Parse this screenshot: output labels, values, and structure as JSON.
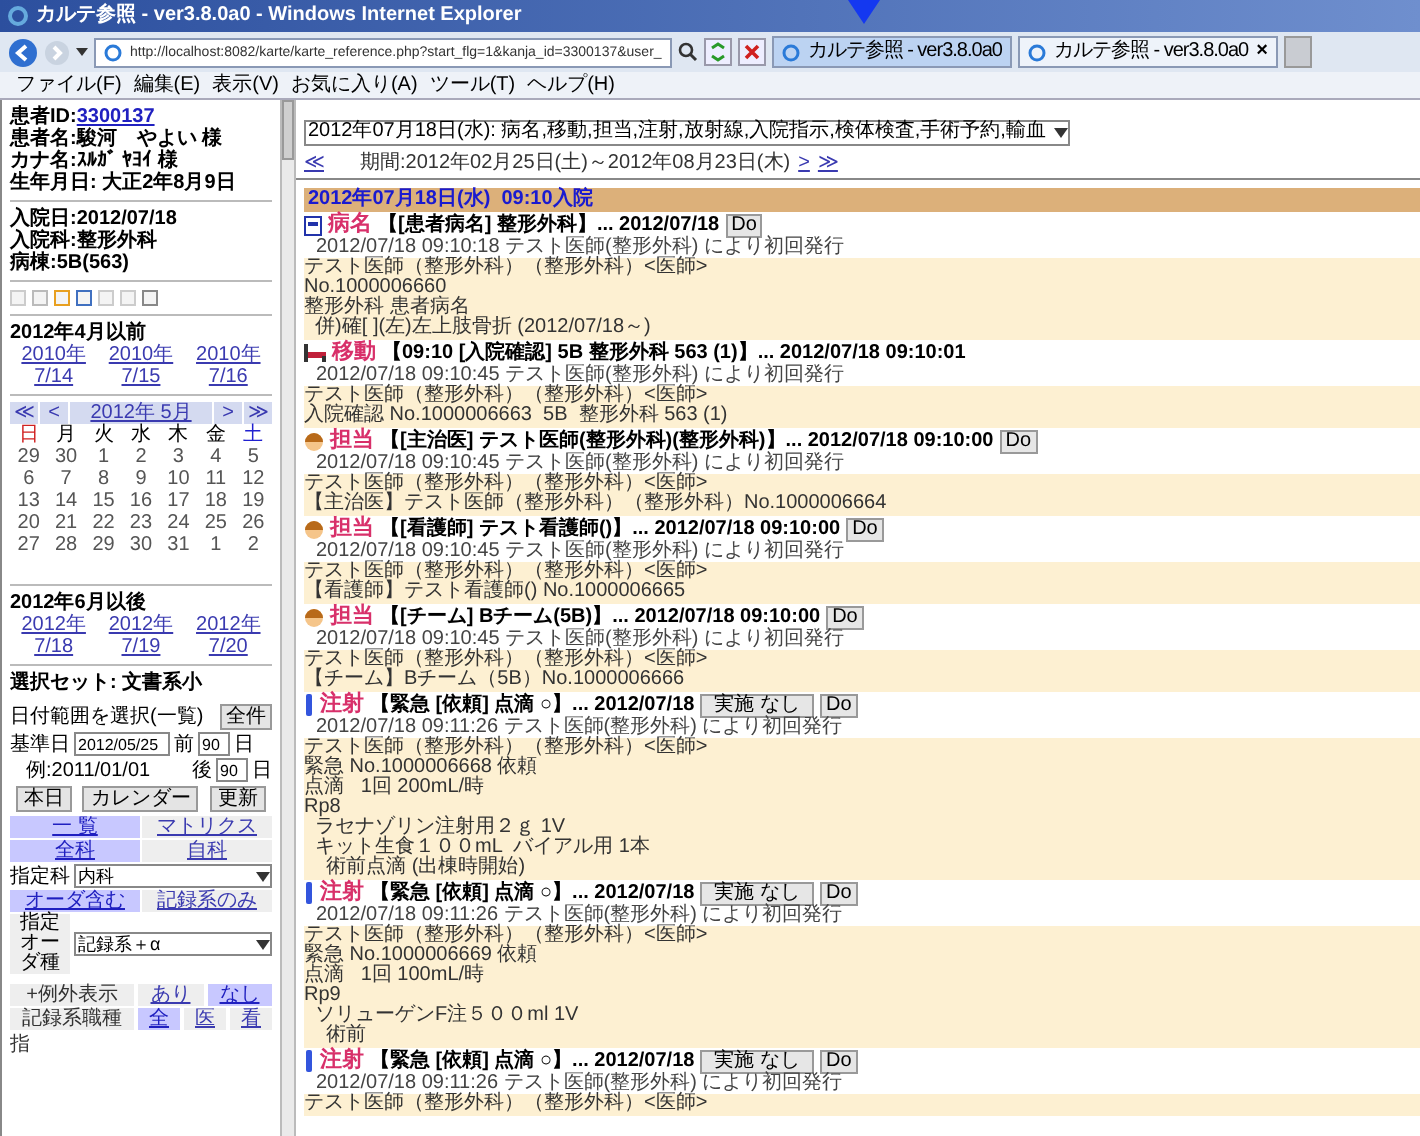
{
  "window": {
    "title": "カルテ参照 - ver3.8.0a0 - Windows Internet Explorer"
  },
  "address_bar": {
    "url": "http://localhost:8082/karte/karte_reference.php?start_flg=1&kanja_id=3300137&user_"
  },
  "tabs": [
    {
      "label": "カルテ参照 - ver3.8.0a0",
      "selected": false
    },
    {
      "label": "カルテ参照 - ver3.8.0a0",
      "selected": true,
      "close": "×"
    }
  ],
  "menu": [
    "ファイル(F)",
    "編集(E)",
    "表示(V)",
    "お気に入り(A)",
    "ツール(T)",
    "ヘルプ(H)"
  ],
  "patient": {
    "id_label": "患者ID:",
    "id": "3300137",
    "lines": [
      "患者名:駿河　やよい 様",
      "カナ名:ｽﾙｶﾞ ﾔﾖｲ 様",
      "生年月日: 大正2年8月9日"
    ]
  },
  "admission": [
    "入院日:2012/07/18",
    "入院科:整形外科",
    "病棟:5B(563)"
  ],
  "before": {
    "title": "2012年4月以前",
    "links": [
      {
        "year": "2010年",
        "date": "7/14"
      },
      {
        "year": "2010年",
        "date": "7/15"
      },
      {
        "year": "2010年",
        "date": "7/16"
      }
    ]
  },
  "calendar": {
    "nav_left": [
      "≪",
      "<"
    ],
    "month": "2012年 5月",
    "nav_right": [
      ">",
      "≫"
    ],
    "weekdays": [
      "日",
      "月",
      "火",
      "水",
      "木",
      "金",
      "土"
    ],
    "weeks": [
      [
        "29",
        "30",
        "1",
        "2",
        "3",
        "4",
        "5"
      ],
      [
        "6",
        "7",
        "8",
        "9",
        "10",
        "11",
        "12"
      ],
      [
        "13",
        "14",
        "15",
        "16",
        "17",
        "18",
        "19"
      ],
      [
        "20",
        "21",
        "22",
        "23",
        "24",
        "25",
        "26"
      ],
      [
        "27",
        "28",
        "29",
        "30",
        "31",
        "1",
        "2"
      ]
    ]
  },
  "after": {
    "title": "2012年6月以後",
    "links": [
      {
        "year": "2012年",
        "date": "7/18"
      },
      {
        "year": "2012年",
        "date": "7/19"
      },
      {
        "year": "2012年",
        "date": "7/20"
      }
    ]
  },
  "selection_set": "選択セット: 文書系小",
  "date_range": {
    "label": "日付範囲を選択(一覧)",
    "all_button": "全件",
    "base_label": "基準日",
    "base_value": "2012/05/25",
    "before_label": "前",
    "before_value": "90",
    "before_unit": "日",
    "example": "例:2011/01/01",
    "after_label": "後",
    "after_value": "90",
    "after_unit": "日"
  },
  "buttons": [
    "本日",
    "カレンダー",
    "更新"
  ],
  "view_toggles": [
    [
      {
        "label": "一 覧",
        "selected": true
      },
      {
        "label": "マトリクス",
        "selected": false
      }
    ],
    [
      {
        "label": "全科",
        "selected": true
      },
      {
        "label": "自科",
        "selected": false
      }
    ]
  ],
  "department": {
    "label": "指定科",
    "value": "内科"
  },
  "order_toggles": [
    {
      "label": "オーダ含む",
      "selected": true
    },
    {
      "label": "記録系のみ",
      "selected": false
    }
  ],
  "order_type": {
    "label": "指定オーダ種",
    "value": "記録系＋α"
  },
  "extra_display": {
    "label": "+例外表示",
    "options": [
      {
        "label": "あり",
        "selected": false
      },
      {
        "label": "なし",
        "selected": true
      }
    ]
  },
  "record_type": {
    "label": "記録系職種",
    "options": [
      {
        "label": "全",
        "selected": true
      },
      {
        "label": "医",
        "selected": false
      },
      {
        "label": "看",
        "selected": false
      }
    ]
  },
  "footer_text": "指",
  "filter_select": {
    "value": "2012年07月18日(水):  病名,移動,担当,注射,放射線,入院指示,検体検査,手術予約,輸血"
  },
  "period": {
    "prev": "≪",
    "label": "期間:2012年02月25日(土)～2012年08月23日(木)",
    "next": ">",
    "next_far": "≫"
  },
  "day_header": "2012年07月18日(水)  09:10入院",
  "entries": [
    {
      "kind": "disease",
      "category": "病名",
      "title": "【[患者病名] 整形外科】... 2012/07/18",
      "buttons": [
        "Do"
      ],
      "sub": "2012/07/18 09:10:18 テスト医師(整形外科) により初回発行",
      "body": [
        "テスト医師（整形外科）（整形外科）<医師>",
        "No.1000006660",
        "整形外科 患者病名",
        "  併)確[ ](左)左上肢骨折 (2012/07/18～)"
      ]
    },
    {
      "kind": "move",
      "category": "移動",
      "title": "【09:10 [入院確認] 5B 整形外科 563 (1)】... 2012/07/18 09:10:01",
      "sub": "2012/07/18 09:10:45 テスト医師(整形外科) により初回発行",
      "body": [
        "テスト医師（整形外科）（整形外科）<医師>",
        "入院確認 No.1000006663  5B  整形外科 563 (1)"
      ]
    },
    {
      "kind": "staff",
      "category": "担当",
      "title": "【[主治医] テスト医師(整形外科)(整形外科)】... 2012/07/18 09:10:00",
      "buttons": [
        "Do"
      ],
      "sub": "2012/07/18 09:10:45 テスト医師(整形外科) により初回発行",
      "body": [
        "テスト医師（整形外科）（整形外科）<医師>",
        "【主治医】テスト医師（整形外科）（整形外科）No.1000006664"
      ]
    },
    {
      "kind": "staff",
      "category": "担当",
      "title": "【[看護師] テスト看護師()】... 2012/07/18 09:10:00",
      "buttons": [
        "Do"
      ],
      "sub": "2012/07/18 09:10:45 テスト医師(整形外科) により初回発行",
      "body": [
        "テスト医師（整形外科）（整形外科）<医師>",
        "【看護師】テスト看護師() No.1000006665"
      ]
    },
    {
      "kind": "staff",
      "category": "担当",
      "title": "【[チーム] Bチーム(5B)】... 2012/07/18 09:10:00",
      "buttons": [
        "Do"
      ],
      "sub": "2012/07/18 09:10:45 テスト医師(整形外科) により初回発行",
      "body": [
        "テスト医師（整形外科）（整形外科）<医師>",
        "【チーム】Bチーム（5B）No.1000006666"
      ]
    },
    {
      "kind": "injection",
      "category": "注射",
      "title": "【緊急 [依頼] 点滴 ○】... 2012/07/18",
      "buttons": [
        "実施 なし",
        "Do"
      ],
      "sub": "2012/07/18 09:11:26 テスト医師(整形外科) により初回発行",
      "body": [
        "テスト医師（整形外科）（整形外科）<医師>",
        "緊急 No.1000006668 依頼",
        "点滴   1回 200mL/時",
        "Rp8",
        "  ラセナゾリン注射用２ｇ 1V",
        "  キット生食１００mL  バイアル用 1本",
        "    術前点滴 (出棟時開始)"
      ]
    },
    {
      "kind": "injection",
      "category": "注射",
      "title": "【緊急 [依頼] 点滴 ○】... 2012/07/18",
      "buttons": [
        "実施 なし",
        "Do"
      ],
      "sub": "2012/07/18 09:11:26 テスト医師(整形外科) により初回発行",
      "body": [
        "テスト医師（整形外科）（整形外科）<医師>",
        "緊急 No.1000006669 依頼",
        "点滴   1回 100mL/時",
        "Rp9",
        "  ソリューゲンF注５００ml 1V",
        "    術前"
      ]
    },
    {
      "kind": "injection",
      "category": "注射",
      "title": "【緊急 [依頼] 点滴 ○】... 2012/07/18",
      "buttons": [
        "実施 なし",
        "Do"
      ],
      "sub": "2012/07/18 09:11:26 テスト医師(整形外科) により初回発行",
      "body": [
        "テスト医師（整形外科）（整形外科）<医師>"
      ]
    }
  ]
}
